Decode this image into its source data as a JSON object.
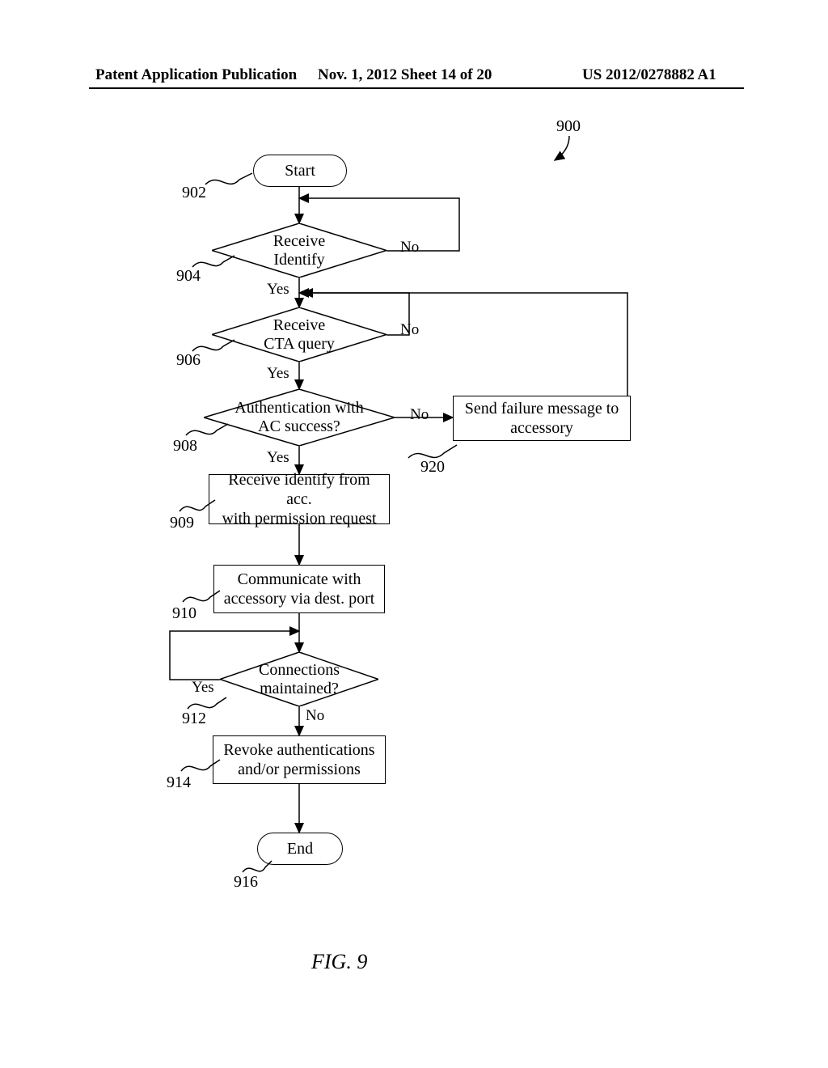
{
  "header": {
    "left": "Patent Application Publication",
    "mid": "Nov. 1, 2012   Sheet 14 of 20",
    "right": "US 2012/0278882 A1"
  },
  "figure": {
    "label": "FIG. 9",
    "callout": "900"
  },
  "refs": {
    "r902": "902",
    "r904": "904",
    "r906": "906",
    "r908": "908",
    "r909": "909",
    "r910": "910",
    "r912": "912",
    "r914": "914",
    "r916": "916",
    "r920": "920"
  },
  "nodes": {
    "start": "Start",
    "end": "End",
    "d904": "Receive\nIdentify",
    "d906": "Receive\nCTA query",
    "d908": "Authentication with\nAC success?",
    "p909": "Receive identify from acc.\nwith permission request",
    "p910": "Communicate with\naccessory via dest. port",
    "d912": "Connections\nmaintained?",
    "p914": "Revoke authentications\nand/or permissions",
    "p920": "Send failure message to\naccessory"
  },
  "edge_labels": {
    "d904_no": "No",
    "d904_yes": "Yes",
    "d906_no": "No",
    "d906_yes": "Yes",
    "d908_no": "No",
    "d908_yes": "Yes",
    "d912_yes": "Yes",
    "d912_no": "No"
  }
}
